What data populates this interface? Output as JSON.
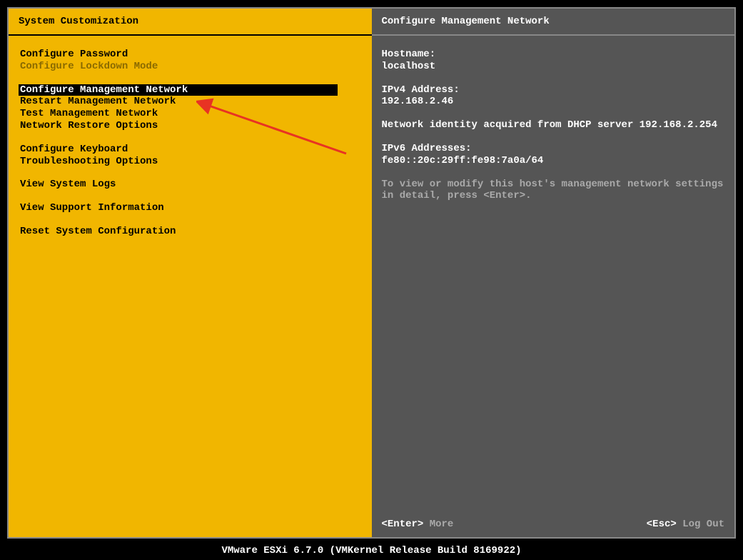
{
  "leftPanel": {
    "title": "System Customization",
    "groups": [
      [
        {
          "label": "Configure Password",
          "state": "normal"
        },
        {
          "label": "Configure Lockdown Mode",
          "state": "disabled"
        }
      ],
      [
        {
          "label": "Configure Management Network",
          "state": "selected"
        },
        {
          "label": "Restart Management Network",
          "state": "normal"
        },
        {
          "label": "Test Management Network",
          "state": "normal"
        },
        {
          "label": "Network Restore Options",
          "state": "normal"
        }
      ],
      [
        {
          "label": "Configure Keyboard",
          "state": "normal"
        },
        {
          "label": "Troubleshooting Options",
          "state": "normal"
        }
      ],
      [
        {
          "label": "View System Logs",
          "state": "normal"
        }
      ],
      [
        {
          "label": "View Support Information",
          "state": "normal"
        }
      ],
      [
        {
          "label": "Reset System Configuration",
          "state": "normal"
        }
      ]
    ]
  },
  "rightPanel": {
    "title": "Configure Management Network",
    "hostnameLabel": "Hostname:",
    "hostnameValue": "localhost",
    "ipv4Label": "IPv4 Address:",
    "ipv4Value": "192.168.2.46",
    "dhcpInfo": "Network identity acquired from DHCP server 192.168.2.254",
    "ipv6Label": "IPv6 Addresses:",
    "ipv6Value": "fe80::20c:29ff:fe98:7a0a/64",
    "hint": "To view or modify this host's management network settings in detail, press <Enter>.",
    "footer": {
      "enterKey": "<Enter>",
      "enterAction": "More",
      "escKey": "<Esc>",
      "escAction": "Log Out"
    }
  },
  "bottomBar": "VMware ESXi 6.7.0 (VMKernel Release Build 8169922)"
}
